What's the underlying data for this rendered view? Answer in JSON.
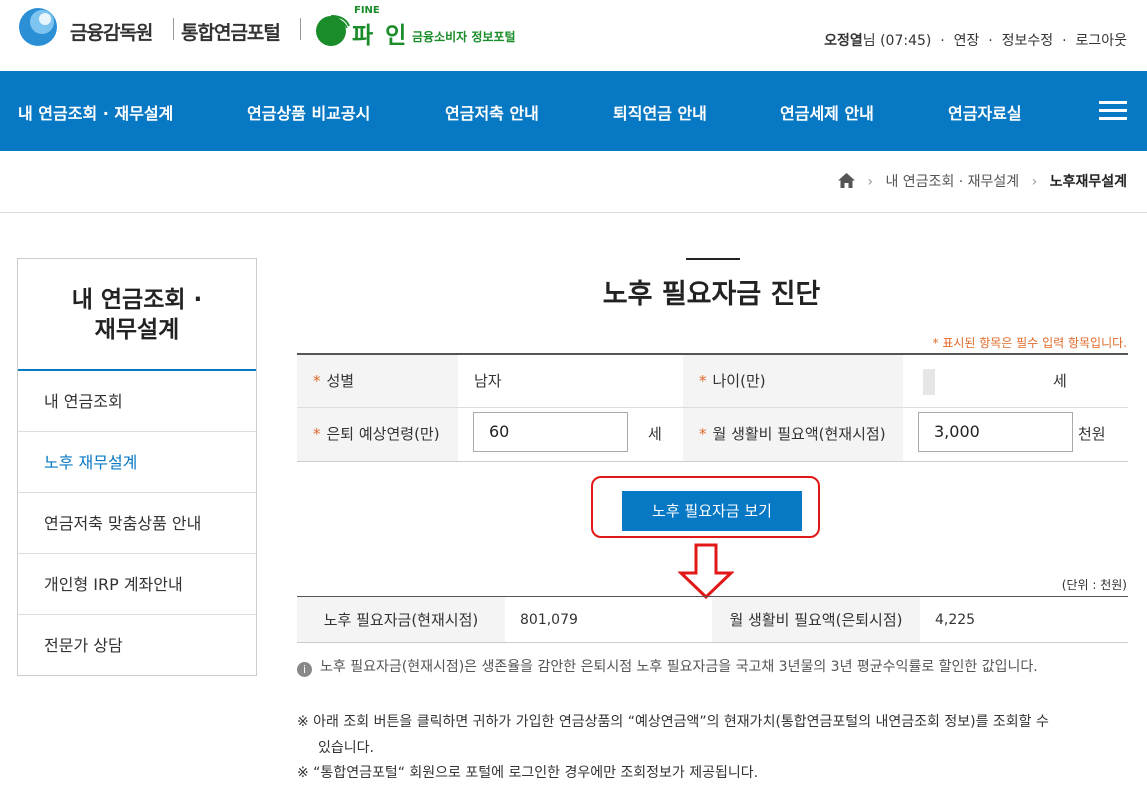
{
  "header": {
    "fss_name": "금융감독원",
    "portal_name": "통합연금포털",
    "fine_small": "FINE",
    "fine_big": "파 인",
    "fine_sub": "금융소비자 정보포털",
    "user_name": "오정열",
    "user_suffix": "님 (07:45)",
    "extend": "연장",
    "edit_info": "정보수정",
    "logout": "로그아웃"
  },
  "nav": {
    "items": [
      "내 연금조회 · 재무설계",
      "연금상품 비교공시",
      "연금저축 안내",
      "퇴직연금 안내",
      "연금세제 안내",
      "연금자료실"
    ]
  },
  "breadcrumb": {
    "parent": "내 연금조회 · 재무설계",
    "current": "노후재무설계"
  },
  "sidebar": {
    "title_line1": "내 연금조회 ·",
    "title_line2": "재무설계",
    "items": [
      {
        "label": "내 연금조회"
      },
      {
        "label": "노후 재무설계"
      },
      {
        "label": "연금저축 맞춤상품 안내"
      },
      {
        "label": "개인형 IRP 계좌안내"
      },
      {
        "label": "전문가 상담"
      }
    ]
  },
  "main": {
    "title": "노후 필요자금 진단",
    "required_note": "표시된 항목은 필수 입력 항목입니다.",
    "star": "*",
    "form": {
      "gender_label": "성별",
      "gender_value": "남자",
      "age_label": "나이(만)",
      "age_unit": "세",
      "retire_label": "은퇴 예상연령(만)",
      "retire_value": "60",
      "retire_unit": "세",
      "living_label": "월 생활비 필요액(현재시점)",
      "living_value": "3,000",
      "living_unit": "천원"
    },
    "button_label": "노후 필요자금 보기",
    "unit_note": "(단위 : 천원)",
    "result": {
      "need_label": "노후 필요자금(현재시점)",
      "need_value": "801,079",
      "monthly_label": "월 생활비 필요액(은퇴시점)",
      "monthly_value": "4,225"
    },
    "info_icon": "i",
    "info_text": "노후 필요자금(현재시점)은 생존율을 감안한 은퇴시점 노후 필요자금을 국고채 3년물의 3년 평균수익률로 할인한 값입니다.",
    "note1_line1": "※ 아래 조회 버튼을 클릭하면 귀하가 가입한 연금상품의 “예상연금액”의 현재가치(통합연금포털의 내연금조회 정보)를 조회할 수",
    "note1_line2": "있습니다.",
    "note2": "※ “통합연금포털“ 회원으로 포털에 로그인한 경우에만 조회정보가 제공됩니다."
  },
  "colors": {
    "primary": "#0778c4",
    "accent": "#e06a2a",
    "highlight": "#e01818",
    "fine_green": "#1a8c2a"
  }
}
